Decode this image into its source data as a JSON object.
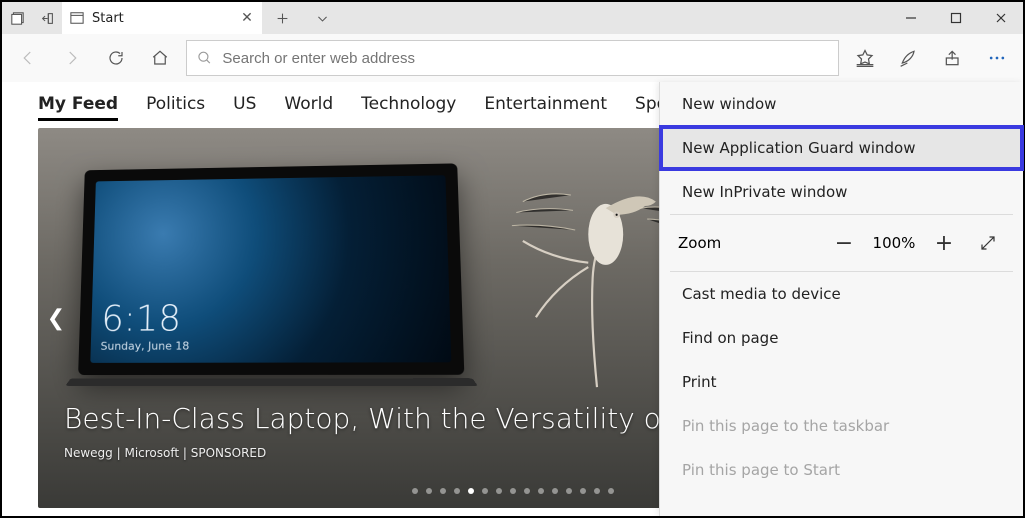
{
  "titlebar": {
    "tab_title": "Start",
    "tab_icon": "start"
  },
  "addressbar": {
    "placeholder": "Search or enter web address",
    "value": ""
  },
  "feed_nav": [
    "My Feed",
    "Politics",
    "US",
    "World",
    "Technology",
    "Entertainment",
    "Sports"
  ],
  "feed_active_index": 0,
  "hero": {
    "lockscreen_time": "6:18",
    "lockscreen_date": "Sunday, June 18",
    "headline": "Best-In-Class Laptop, With the Versatility of a Studio & Tablet",
    "byline": "Newegg | Microsoft | SPONSORED",
    "slide_count": 15,
    "slide_active": 4
  },
  "menu": {
    "new_window": "New window",
    "new_app_guard": "New Application Guard window",
    "new_inprivate": "New InPrivate window",
    "zoom_label": "Zoom",
    "zoom_value": "100%",
    "cast": "Cast media to device",
    "find": "Find on page",
    "print": "Print",
    "pin_taskbar": "Pin this page to the taskbar",
    "pin_start": "Pin this page to Start"
  }
}
